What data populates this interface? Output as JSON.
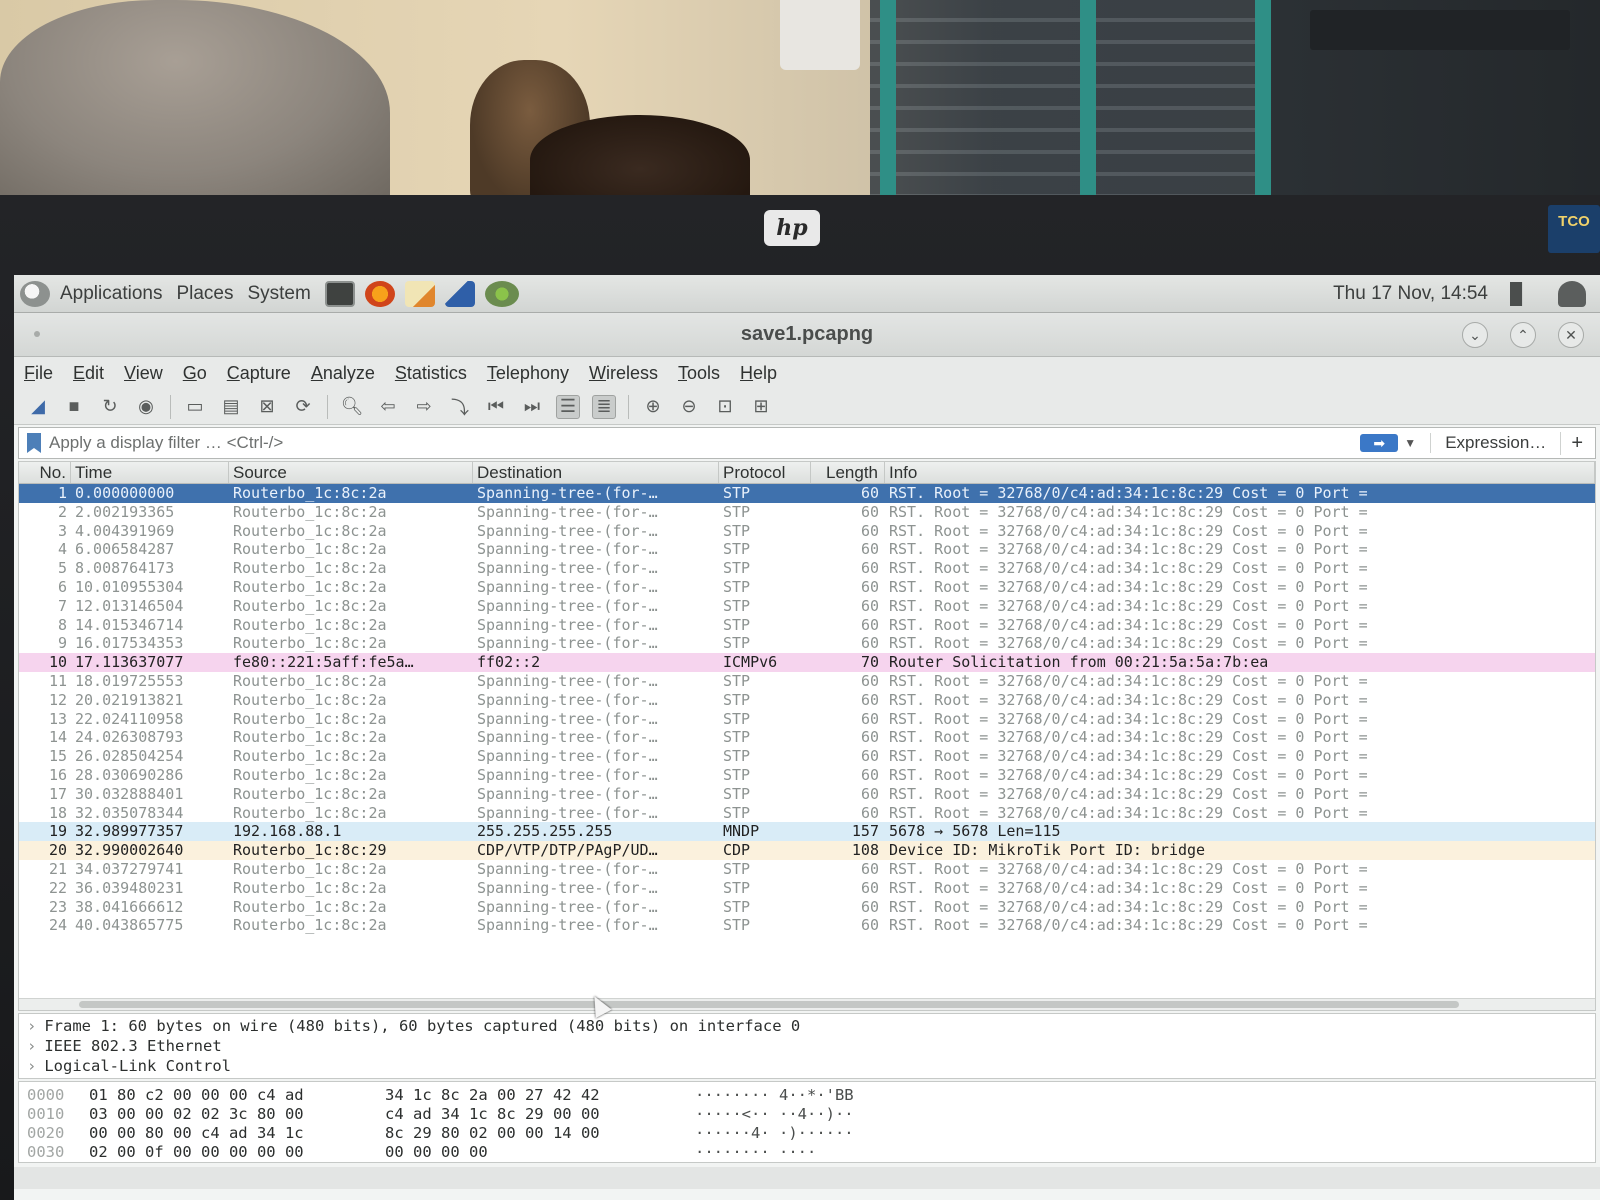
{
  "panel": {
    "menus": [
      "Applications",
      "Places",
      "System"
    ],
    "clock": "Thu 17 Nov, 14:54"
  },
  "window": {
    "title": "save1.pcapng"
  },
  "menubar": [
    "File",
    "Edit",
    "View",
    "Go",
    "Capture",
    "Analyze",
    "Statistics",
    "Telephony",
    "Wireless",
    "Tools",
    "Help"
  ],
  "filter": {
    "placeholder": "Apply a display filter … <Ctrl-/>",
    "expression_label": "Expression…",
    "plus_label": "+"
  },
  "columns": [
    "No.",
    "Time",
    "Source",
    "Destination",
    "Protocol",
    "Length",
    "Info"
  ],
  "packets": [
    {
      "no": "1",
      "time": "0.000000000",
      "src": "Routerbo_1c:8c:2a",
      "dst": "Spanning-tree-(for-…",
      "proto": "STP",
      "len": "60",
      "info": "RST. Root = 32768/0/c4:ad:34:1c:8c:29  Cost = 0  Port =",
      "kind": "sel"
    },
    {
      "no": "2",
      "time": "2.002193365",
      "src": "Routerbo_1c:8c:2a",
      "dst": "Spanning-tree-(for-…",
      "proto": "STP",
      "len": "60",
      "info": "RST. Root = 32768/0/c4:ad:34:1c:8c:29  Cost = 0  Port =",
      "kind": "stp"
    },
    {
      "no": "3",
      "time": "4.004391969",
      "src": "Routerbo_1c:8c:2a",
      "dst": "Spanning-tree-(for-…",
      "proto": "STP",
      "len": "60",
      "info": "RST. Root = 32768/0/c4:ad:34:1c:8c:29  Cost = 0  Port =",
      "kind": "stp"
    },
    {
      "no": "4",
      "time": "6.006584287",
      "src": "Routerbo_1c:8c:2a",
      "dst": "Spanning-tree-(for-…",
      "proto": "STP",
      "len": "60",
      "info": "RST. Root = 32768/0/c4:ad:34:1c:8c:29  Cost = 0  Port =",
      "kind": "stp"
    },
    {
      "no": "5",
      "time": "8.008764173",
      "src": "Routerbo_1c:8c:2a",
      "dst": "Spanning-tree-(for-…",
      "proto": "STP",
      "len": "60",
      "info": "RST. Root = 32768/0/c4:ad:34:1c:8c:29  Cost = 0  Port =",
      "kind": "stp"
    },
    {
      "no": "6",
      "time": "10.010955304",
      "src": "Routerbo_1c:8c:2a",
      "dst": "Spanning-tree-(for-…",
      "proto": "STP",
      "len": "60",
      "info": "RST. Root = 32768/0/c4:ad:34:1c:8c:29  Cost = 0  Port =",
      "kind": "stp"
    },
    {
      "no": "7",
      "time": "12.013146504",
      "src": "Routerbo_1c:8c:2a",
      "dst": "Spanning-tree-(for-…",
      "proto": "STP",
      "len": "60",
      "info": "RST. Root = 32768/0/c4:ad:34:1c:8c:29  Cost = 0  Port =",
      "kind": "stp"
    },
    {
      "no": "8",
      "time": "14.015346714",
      "src": "Routerbo_1c:8c:2a",
      "dst": "Spanning-tree-(for-…",
      "proto": "STP",
      "len": "60",
      "info": "RST. Root = 32768/0/c4:ad:34:1c:8c:29  Cost = 0  Port =",
      "kind": "stp"
    },
    {
      "no": "9",
      "time": "16.017534353",
      "src": "Routerbo_1c:8c:2a",
      "dst": "Spanning-tree-(for-…",
      "proto": "STP",
      "len": "60",
      "info": "RST. Root = 32768/0/c4:ad:34:1c:8c:29  Cost = 0  Port =",
      "kind": "stp"
    },
    {
      "no": "10",
      "time": "17.113637077",
      "src": "fe80::221:5aff:fe5a…",
      "dst": "ff02::2",
      "proto": "ICMPv6",
      "len": "70",
      "info": "Router Solicitation from 00:21:5a:5a:7b:ea",
      "kind": "icmp"
    },
    {
      "no": "11",
      "time": "18.019725553",
      "src": "Routerbo_1c:8c:2a",
      "dst": "Spanning-tree-(for-…",
      "proto": "STP",
      "len": "60",
      "info": "RST. Root = 32768/0/c4:ad:34:1c:8c:29  Cost = 0  Port =",
      "kind": "stp"
    },
    {
      "no": "12",
      "time": "20.021913821",
      "src": "Routerbo_1c:8c:2a",
      "dst": "Spanning-tree-(for-…",
      "proto": "STP",
      "len": "60",
      "info": "RST. Root = 32768/0/c4:ad:34:1c:8c:29  Cost = 0  Port =",
      "kind": "stp"
    },
    {
      "no": "13",
      "time": "22.024110958",
      "src": "Routerbo_1c:8c:2a",
      "dst": "Spanning-tree-(for-…",
      "proto": "STP",
      "len": "60",
      "info": "RST. Root = 32768/0/c4:ad:34:1c:8c:29  Cost = 0  Port =",
      "kind": "stp"
    },
    {
      "no": "14",
      "time": "24.026308793",
      "src": "Routerbo_1c:8c:2a",
      "dst": "Spanning-tree-(for-…",
      "proto": "STP",
      "len": "60",
      "info": "RST. Root = 32768/0/c4:ad:34:1c:8c:29  Cost = 0  Port =",
      "kind": "stp"
    },
    {
      "no": "15",
      "time": "26.028504254",
      "src": "Routerbo_1c:8c:2a",
      "dst": "Spanning-tree-(for-…",
      "proto": "STP",
      "len": "60",
      "info": "RST. Root = 32768/0/c4:ad:34:1c:8c:29  Cost = 0  Port =",
      "kind": "stp"
    },
    {
      "no": "16",
      "time": "28.030690286",
      "src": "Routerbo_1c:8c:2a",
      "dst": "Spanning-tree-(for-…",
      "proto": "STP",
      "len": "60",
      "info": "RST. Root = 32768/0/c4:ad:34:1c:8c:29  Cost = 0  Port =",
      "kind": "stp"
    },
    {
      "no": "17",
      "time": "30.032888401",
      "src": "Routerbo_1c:8c:2a",
      "dst": "Spanning-tree-(for-…",
      "proto": "STP",
      "len": "60",
      "info": "RST. Root = 32768/0/c4:ad:34:1c:8c:29  Cost = 0  Port =",
      "kind": "stp"
    },
    {
      "no": "18",
      "time": "32.035078344",
      "src": "Routerbo_1c:8c:2a",
      "dst": "Spanning-tree-(for-…",
      "proto": "STP",
      "len": "60",
      "info": "RST. Root = 32768/0/c4:ad:34:1c:8c:29  Cost = 0  Port =",
      "kind": "stp"
    },
    {
      "no": "19",
      "time": "32.989977357",
      "src": "192.168.88.1",
      "dst": "255.255.255.255",
      "proto": "MNDP",
      "len": "157",
      "info": "5678 → 5678 Len=115",
      "kind": "mndp"
    },
    {
      "no": "20",
      "time": "32.990002640",
      "src": "Routerbo_1c:8c:29",
      "dst": "CDP/VTP/DTP/PAgP/UD…",
      "proto": "CDP",
      "len": "108",
      "info": "Device ID: MikroTik  Port ID: bridge",
      "kind": "cdp"
    },
    {
      "no": "21",
      "time": "34.037279741",
      "src": "Routerbo_1c:8c:2a",
      "dst": "Spanning-tree-(for-…",
      "proto": "STP",
      "len": "60",
      "info": "RST. Root = 32768/0/c4:ad:34:1c:8c:29  Cost = 0  Port =",
      "kind": "stp"
    },
    {
      "no": "22",
      "time": "36.039480231",
      "src": "Routerbo_1c:8c:2a",
      "dst": "Spanning-tree-(for-…",
      "proto": "STP",
      "len": "60",
      "info": "RST. Root = 32768/0/c4:ad:34:1c:8c:29  Cost = 0  Port =",
      "kind": "stp"
    },
    {
      "no": "23",
      "time": "38.041666612",
      "src": "Routerbo_1c:8c:2a",
      "dst": "Spanning-tree-(for-…",
      "proto": "STP",
      "len": "60",
      "info": "RST. Root = 32768/0/c4:ad:34:1c:8c:29  Cost = 0  Port =",
      "kind": "stp"
    },
    {
      "no": "24",
      "time": "40.043865775",
      "src": "Routerbo_1c:8c:2a",
      "dst": "Spanning-tree-(for-…",
      "proto": "STP",
      "len": "60",
      "info": "RST. Root = 32768/0/c4:ad:34:1c:8c:29  Cost = 0  Port =",
      "kind": "stp"
    }
  ],
  "details": [
    "Frame 1: 60 bytes on wire (480 bits), 60 bytes captured (480 bits) on interface 0",
    "IEEE 802.3 Ethernet",
    "Logical-Link Control"
  ],
  "bytes": [
    {
      "off": "0000",
      "hex1": "01 80 c2 00 00 00 c4 ad",
      "hex2": "34 1c 8c 2a 00 27 42 42",
      "ascii": "········ 4··*·'BB"
    },
    {
      "off": "0010",
      "hex1": "03 00 00 02 02 3c 80 00",
      "hex2": "c4 ad 34 1c 8c 29 00 00",
      "ascii": "·····<·· ··4··)··"
    },
    {
      "off": "0020",
      "hex1": "00 00 80 00 c4 ad 34 1c",
      "hex2": "8c 29 80 02 00 00 14 00",
      "ascii": "······4· ·)······"
    },
    {
      "off": "0030",
      "hex1": "02 00 0f 00 00 00 00 00",
      "hex2": "00 00 00 00",
      "ascii": "········ ····"
    }
  ],
  "colors": {
    "selected_row": "#3f71ad",
    "icmp_row": "#f6d4ee",
    "mndp_row": "#d9ecf7",
    "cdp_row": "#fbf1dd"
  },
  "icons": {
    "toolbar": [
      "shark-fin-icon",
      "stop-icon",
      "restart-icon",
      "options-icon",
      "open-icon",
      "save-icon",
      "close-file-icon",
      "reload-icon",
      "find-icon",
      "back-icon",
      "forward-icon",
      "goto-icon",
      "first-icon",
      "last-icon",
      "autoscroll-icon",
      "colorize-icon",
      "zoom-in-icon",
      "zoom-out-icon",
      "normal-size-icon",
      "resize-columns-icon"
    ]
  }
}
